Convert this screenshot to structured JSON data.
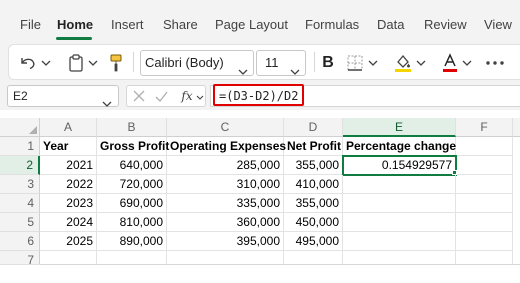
{
  "menu": {
    "file": "File",
    "home": "Home",
    "insert": "Insert",
    "share": "Share",
    "page_layout": "Page Layout",
    "formulas": "Formulas",
    "data": "Data",
    "review": "Review",
    "view": "View"
  },
  "ribbon": {
    "font_name": "Calibri (Body)",
    "font_size": "11",
    "bold_label": "B",
    "icons": [
      "undo-icon",
      "clipboard-icon",
      "format-painter-icon",
      "borders-icon",
      "fill-color-icon",
      "font-color-icon",
      "more-icon"
    ],
    "fill_color": "#f5d400",
    "font_color": "#e00000"
  },
  "formula_bar": {
    "name_box": "E2",
    "formula": "=(D3-D2)/D2",
    "fx_label": "fx"
  },
  "sheet": {
    "columns": [
      "A",
      "B",
      "C",
      "D",
      "E",
      "F"
    ],
    "selected_column": "E",
    "row_numbers": [
      "1",
      "2",
      "3",
      "4",
      "5",
      "6",
      "7"
    ],
    "selected_row": "2",
    "headers": [
      "Year",
      "Gross Profit",
      "Operating Expenses",
      "Net Profit",
      "Percentage change"
    ],
    "rows": [
      {
        "year": "2021",
        "gross": "640,000",
        "opex": "285,000",
        "net": "355,000",
        "pct": "0.154929577"
      },
      {
        "year": "2022",
        "gross": "720,000",
        "opex": "310,000",
        "net": "410,000",
        "pct": ""
      },
      {
        "year": "2023",
        "gross": "690,000",
        "opex": "335,000",
        "net": "355,000",
        "pct": ""
      },
      {
        "year": "2024",
        "gross": "810,000",
        "opex": "360,000",
        "net": "450,000",
        "pct": ""
      },
      {
        "year": "2025",
        "gross": "890,000",
        "opex": "395,000",
        "net": "495,000",
        "pct": ""
      }
    ],
    "accent_color": "#107c41",
    "highlight_color": "#e00000"
  }
}
